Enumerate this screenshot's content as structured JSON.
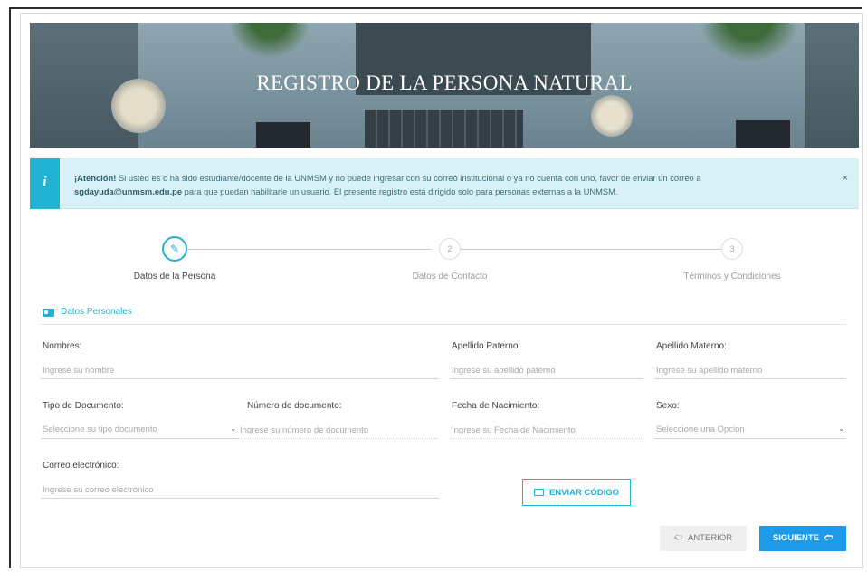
{
  "banner": {
    "title": "REGISTRO DE LA PERSONA NATURAL"
  },
  "alert": {
    "icon": "i",
    "strong": "¡Atención!",
    "text1": " Si usted es o ha sido estudiante/docente de la UNMSM y no puede ingresar con su correo institucional o ya no cuenta con uno, favor de enviar un correo a",
    "email": "sgdayuda@unmsm.edu.pe",
    "text2": " para que puedan habilitarle un usuario. El presente registro está dirigido solo para personas externas a la UNMSM.",
    "close": "×"
  },
  "stepper": {
    "steps": [
      {
        "number": "✎",
        "label": "Datos de la Persona"
      },
      {
        "number": "2",
        "label": "Datos de Contacto"
      },
      {
        "number": "3",
        "label": "Términos y Condiciones"
      }
    ]
  },
  "section": {
    "title": "Datos Personales"
  },
  "form": {
    "nombres": {
      "label": "Nombres:",
      "placeholder": "Ingrese su nombre",
      "value": ""
    },
    "apellido_paterno": {
      "label": "Apellido Paterno:",
      "placeholder": "Ingrese su apellido paterno",
      "value": ""
    },
    "apellido_materno": {
      "label": "Apellido Materno:",
      "placeholder": "Ingrese su apellido materno",
      "value": ""
    },
    "tipo_documento": {
      "label": "Tipo de Documento:",
      "selected": "Seleccione su tipo documento"
    },
    "numero_documento": {
      "label": "Número de documento:",
      "placeholder": "Ingrese su número de documento",
      "value": ""
    },
    "fecha_nacimiento": {
      "label": "Fecha de Nacimiento:",
      "placeholder": "Ingrese su Fecha de Nacimiento",
      "value": ""
    },
    "sexo": {
      "label": "Sexo:",
      "selected": "Seleccione una Opcion"
    },
    "correo": {
      "label": "Correo electrónico:",
      "placeholder": "Ingrese su correo electrónico",
      "value": ""
    }
  },
  "buttons": {
    "send_code": "ENVIAR CÓDIGO",
    "previous": "ANTERIOR",
    "next": "SIGUIENTE"
  },
  "colors": {
    "accent": "#21b3d3",
    "primary": "#1f9ae8",
    "alert_bg": "#d8f1f6"
  }
}
